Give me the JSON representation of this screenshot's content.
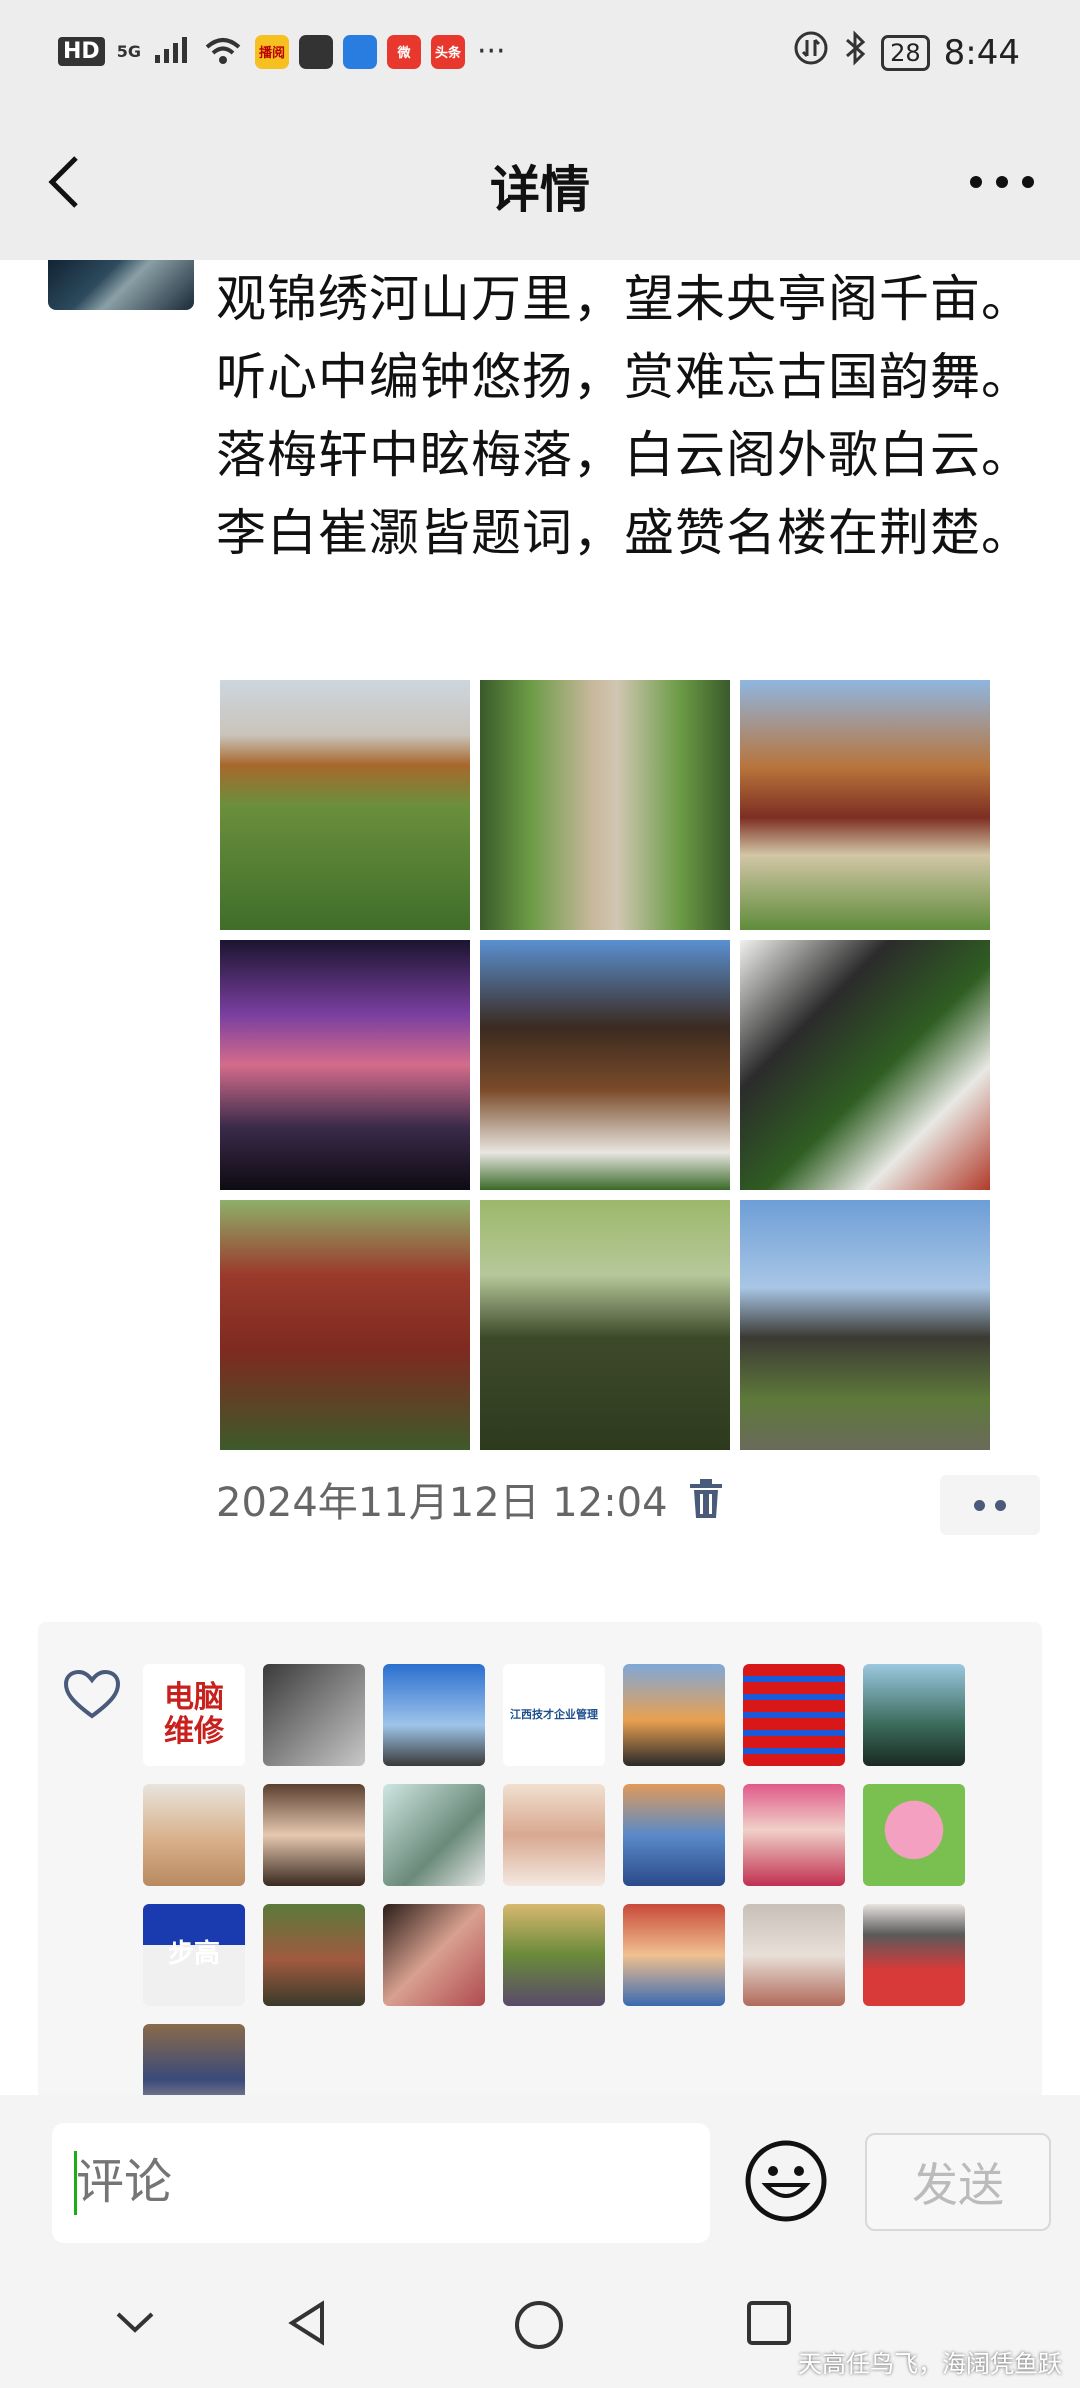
{
  "status_bar": {
    "hd": "HD",
    "network": "5G",
    "apps": [
      {
        "name": "news-app-icon",
        "label": "播阅",
        "bg": "#f5c020",
        "fg": "#b00"
      },
      {
        "name": "bag-app-icon",
        "label": "",
        "bg": "#333",
        "fg": "#fff"
      },
      {
        "name": "browser-app-icon",
        "label": "",
        "bg": "#2a7de0",
        "fg": "#fff"
      },
      {
        "name": "weibo-app-icon",
        "label": "微",
        "bg": "#e8382e",
        "fg": "#fff"
      },
      {
        "name": "toutiao-app-icon",
        "label": "头条",
        "bg": "#e8382e",
        "fg": "#fff"
      }
    ],
    "overflow": "···",
    "battery": "28",
    "time": "8:44"
  },
  "header": {
    "title": "详情"
  },
  "post": {
    "text": "观锦绣河山万里，望未央亭阁千亩。听心中编钟悠扬，赏难忘古国韵舞。落梅轩中眩梅落，白云阁外歌白云。李白崔灏皆题词，盛赞名楼在荆楚。",
    "photos": [
      {
        "name": "photo-yellow-crane-tower"
      },
      {
        "name": "photo-garden-aerial"
      },
      {
        "name": "photo-pavilion-gate"
      },
      {
        "name": "photo-stage-performance"
      },
      {
        "name": "photo-tower-pavilion"
      },
      {
        "name": "photo-white-wall-pavilion"
      },
      {
        "name": "photo-red-pavilion"
      },
      {
        "name": "photo-pond-ducks"
      },
      {
        "name": "photo-crane-statue"
      }
    ],
    "timestamp": "2024年11月12日 12:04"
  },
  "likes": {
    "avatars": [
      {
        "name": "avatar-computer-repair",
        "text": "电脑\n维修",
        "bg": "#ffffff",
        "fg": "#c8201c"
      },
      {
        "name": "avatar-baby-cat",
        "text": "",
        "bg": "linear-gradient(135deg,#3a3a3a,#c8c8c8)",
        "fg": "#fff"
      },
      {
        "name": "avatar-astronaut",
        "text": "",
        "bg": "linear-gradient(180deg,#2a6fd0,#9ec4ea 60%,#3a3a3a)",
        "fg": "#fff"
      },
      {
        "name": "avatar-enterprise-logo",
        "text": "江西技才企业管理",
        "bg": "#ffffff",
        "fg": "#1c4f8c"
      },
      {
        "name": "avatar-horse-rider",
        "text": "",
        "bg": "linear-gradient(180deg,#7fa8d8,#e8a050 55%,#2a2a2a)",
        "fg": "#fff"
      },
      {
        "name": "avatar-trigram",
        "text": "",
        "bg": "repeating-linear-gradient(180deg,#d81818 0 12px,#1a5ad8 12px 18px)",
        "fg": "#fff"
      },
      {
        "name": "avatar-woman-green",
        "text": "",
        "bg": "linear-gradient(180deg,#9cc8e0,#3a6a5a 60%,#1a2a22)",
        "fg": "#fff"
      },
      {
        "name": "avatar-woman-sweater",
        "text": "",
        "bg": "linear-gradient(180deg,#e8e4de,#d8b08a 55%,#b88a60)",
        "fg": "#fff"
      },
      {
        "name": "avatar-woman-long-hair",
        "text": "",
        "bg": "linear-gradient(180deg,#5a4030,#e6c8b0 50%,#3a2a20)",
        "fg": "#fff"
      },
      {
        "name": "avatar-cat-flag",
        "text": "",
        "bg": "linear-gradient(135deg,#cfe6e2,#6a8a7a 60%,#e8e8e8)",
        "fg": "#fff"
      },
      {
        "name": "avatar-woman-flowers",
        "text": "",
        "bg": "linear-gradient(180deg,#f0e0d0,#d8a890 50%,#f4e8e0)",
        "fg": "#fff"
      },
      {
        "name": "avatar-woman-blue-dress",
        "text": "",
        "bg": "linear-gradient(180deg,#e09a5a,#5a8ac8 50%,#2a4a8a)",
        "fg": "#fff"
      },
      {
        "name": "avatar-woman-red",
        "text": "",
        "bg": "linear-gradient(180deg,#e05a8a,#f0d0c8 45%,#c03050)",
        "fg": "#fff"
      },
      {
        "name": "avatar-peppa-pig",
        "text": "",
        "bg": "radial-gradient(circle at 50% 45%,#f4a0c0 0 38%,#7ac050 39%)",
        "fg": "#fff"
      },
      {
        "name": "avatar-education",
        "text": "步高",
        "bg": "linear-gradient(180deg,#1a3ab0,#1a3ab0 40%,#f0f0f0 40%)",
        "fg": "#ffffff"
      },
      {
        "name": "avatar-couple-garden",
        "text": "",
        "bg": "linear-gradient(180deg,#5a7a3a,#a05a40 55%,#3a3a2a)",
        "fg": "#fff"
      },
      {
        "name": "avatar-money",
        "text": "",
        "bg": "linear-gradient(135deg,#2a1e18,#d8a090 50%,#b04a50)",
        "fg": "#fff"
      },
      {
        "name": "avatar-man-flowers",
        "text": "",
        "bg": "linear-gradient(180deg,#d8b870,#6a8a3a 50%,#5a4a6a)",
        "fg": "#fff"
      },
      {
        "name": "avatar-woman-glasses",
        "text": "",
        "bg": "linear-gradient(180deg,#c84a3a,#f0c090 50%,#3a6ab0)",
        "fg": "#fff"
      },
      {
        "name": "avatar-woman-mask",
        "text": "",
        "bg": "linear-gradient(180deg,#c8c0b8,#e8e0d8 50%,#b06a5a)",
        "fg": "#fff"
      },
      {
        "name": "avatar-woman-hat",
        "text": "",
        "bg": "linear-gradient(180deg,#e8e4e0,#5a5a5a 30%,#d83a3a 65%)",
        "fg": "#fff"
      },
      {
        "name": "avatar-couple-indoor",
        "text": "",
        "bg": "linear-gradient(180deg,#8a6a4a,#3a4a7a 55%,#d8c0a0)",
        "fg": "#fff"
      }
    ]
  },
  "composer": {
    "placeholder": "评论",
    "send_label": "发送"
  },
  "watermark": "天高任鸟飞，海阔凭鱼跃"
}
